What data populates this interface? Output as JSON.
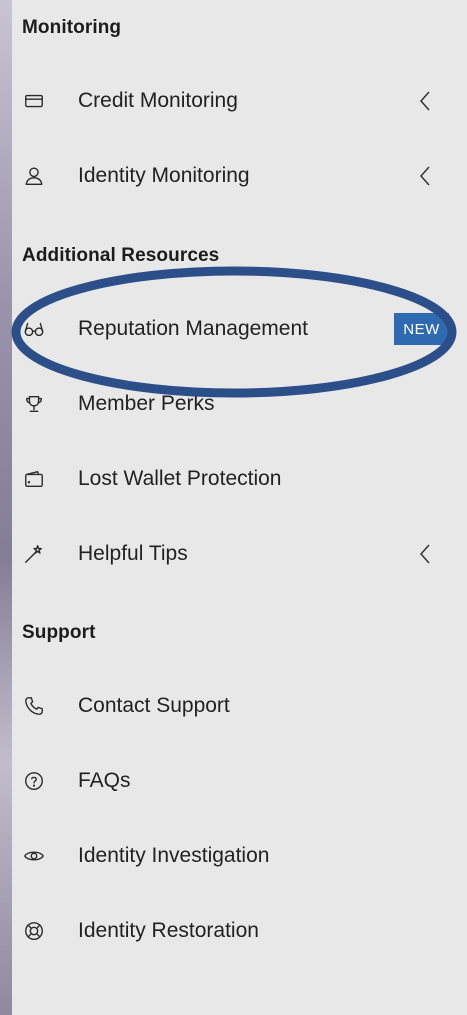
{
  "sections": {
    "monitoring": {
      "title": "Monitoring",
      "items": [
        {
          "label": "Credit Monitoring",
          "icon": "credit-card-icon"
        },
        {
          "label": "Identity Monitoring",
          "icon": "user-icon"
        }
      ]
    },
    "additional": {
      "title": "Additional Resources",
      "items": [
        {
          "label": "Reputation Management",
          "icon": "glasses-icon",
          "badge": "NEW"
        },
        {
          "label": "Member Perks",
          "icon": "trophy-icon"
        },
        {
          "label": "Lost Wallet Protection",
          "icon": "wallet-icon"
        },
        {
          "label": "Helpful Tips",
          "icon": "magic-wand-icon"
        }
      ]
    },
    "support": {
      "title": "Support",
      "items": [
        {
          "label": "Contact Support",
          "icon": "phone-icon"
        },
        {
          "label": "FAQs",
          "icon": "help-circle-icon"
        },
        {
          "label": "Identity Investigation",
          "icon": "eye-icon"
        },
        {
          "label": "Identity Restoration",
          "icon": "life-ring-icon"
        }
      ]
    }
  },
  "colors": {
    "panel_bg": "#e8e8e8",
    "badge_bg": "#2f6ab0",
    "highlight_ellipse": "#2c4f8a"
  }
}
